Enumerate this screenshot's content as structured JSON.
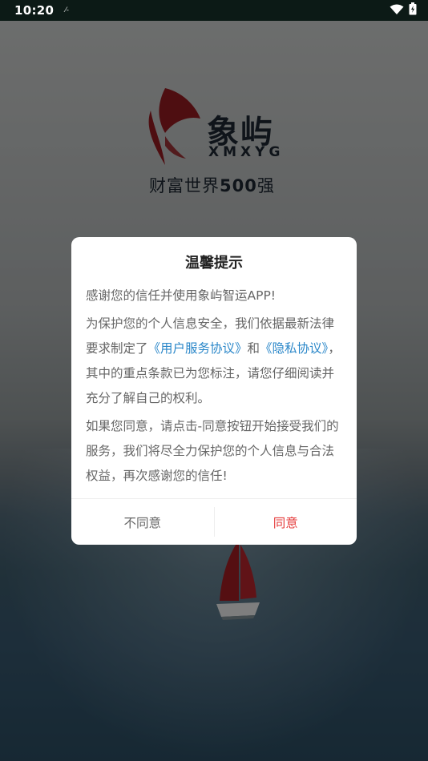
{
  "status_bar": {
    "time": "10:20",
    "notification_glyph": "⁄-",
    "icons": [
      "wifi-icon",
      "battery-icon"
    ]
  },
  "splash": {
    "brand_name": "象屿",
    "brand_sub": "XMXYG",
    "tagline_prefix": "财富世界",
    "tagline_number": "500",
    "tagline_suffix": "强",
    "accent_color": "#8e1a1f"
  },
  "dialog": {
    "title": "温馨提示",
    "para1": "感谢您的信任并使用象屿智运APP!",
    "para2_a": "为保护您的个人信息安全，我们依据最新法律要求制定了",
    "link_user_agreement": "《用户服务协议》",
    "para2_and": "和",
    "link_privacy": "《隐私协议》",
    "para2_b": "，其中的重点条款已为您标注，请您仔细阅读并充分了解自己的权利。",
    "para3": "如果您同意，请点击-同意按钮开始接受我们的服务，我们将尽全力保护您的个人信息与合法权益，再次感谢您的信任!",
    "disagree_label": "不同意",
    "agree_label": "同意",
    "link_color": "#2a87c9",
    "agree_color": "#e53b3b"
  }
}
